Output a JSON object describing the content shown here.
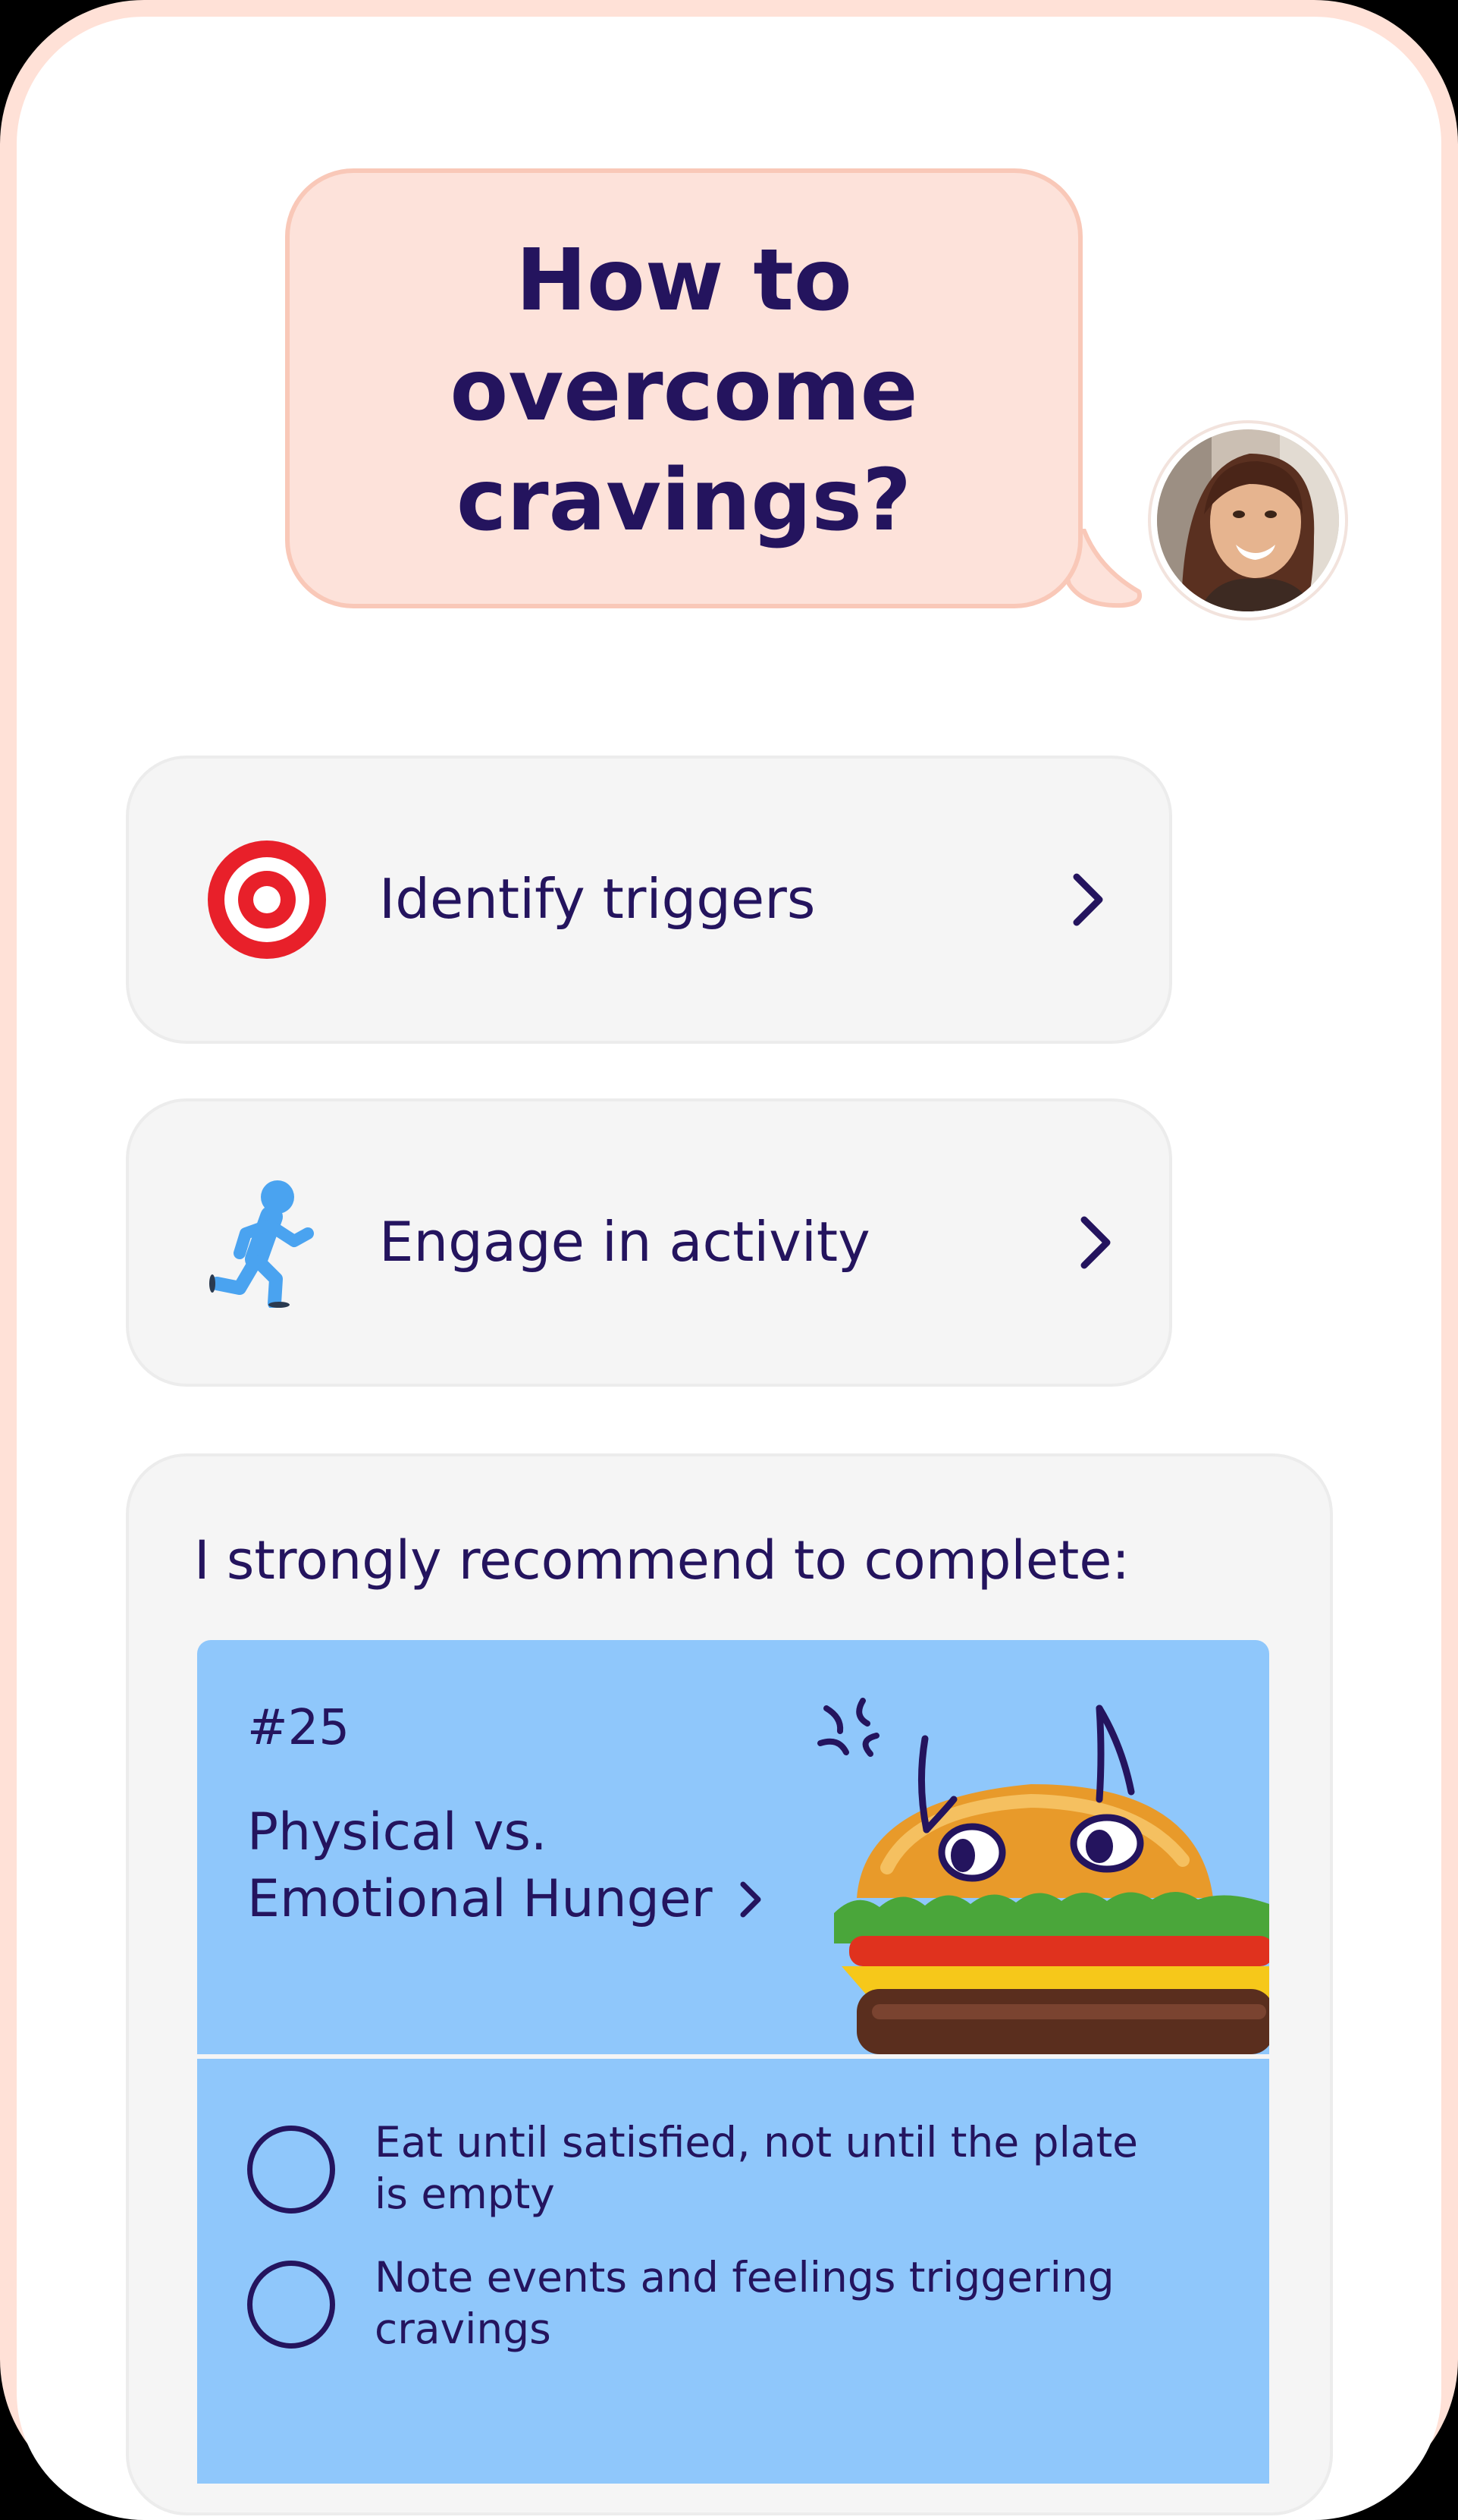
{
  "chat": {
    "question": "How to\novercome\ncravings?"
  },
  "actions": [
    {
      "label": "Identify triggers",
      "icon": "target-icon"
    },
    {
      "label": "Engage in activity",
      "icon": "running-person-icon"
    }
  ],
  "recommendation": {
    "heading": "I strongly recommend to complete:",
    "lesson": {
      "number": "#25",
      "title_line1": "Physical vs.",
      "title_line2": "Emotional Hunger"
    },
    "tasks": [
      {
        "text": "Eat until satisfied, not until the plate is empty"
      },
      {
        "text": "Note events and feelings triggering cravings"
      }
    ]
  },
  "colors": {
    "frame": "#ffe1d7",
    "bubble": "#fde2da",
    "text": "#24145e",
    "card": "#f5f5f5",
    "lesson": "#8fc7fb",
    "target_red": "#e8202a",
    "runner_blue": "#4aa3f0"
  }
}
